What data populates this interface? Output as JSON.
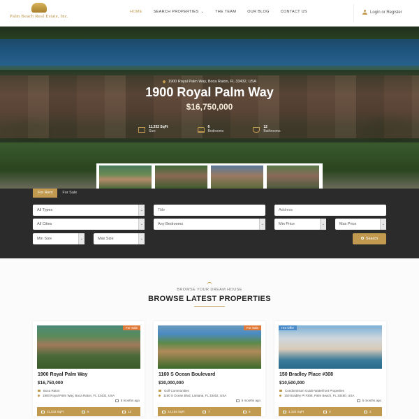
{
  "header": {
    "logo_text": "Palm Beach Real Estate, Inc.",
    "nav": [
      {
        "label": "HOME",
        "active": true
      },
      {
        "label": "SEARCH PROPERTIES",
        "active": false
      },
      {
        "label": "THE TEAM",
        "active": false
      },
      {
        "label": "OUR BLOG",
        "active": false
      },
      {
        "label": "CONTACT US",
        "active": false
      }
    ],
    "login_label": "Login or Register"
  },
  "hero": {
    "address": "1900 Royal Palm Way, Boca Raton, FL 33432, USA",
    "title": "1900 Royal Palm Way",
    "price": "$16,750,000",
    "stats": [
      {
        "value": "11,332 SqFt",
        "label": "Size"
      },
      {
        "value": "6",
        "label": "Bedrooms"
      },
      {
        "value": "12",
        "label": "Bathrooms"
      }
    ]
  },
  "search": {
    "tabs": [
      "For Rent",
      "For Sale"
    ],
    "types": "All Types",
    "title_placeholder": "Title",
    "address_placeholder": "Address",
    "cities": "All Cities",
    "bedrooms": "Any Bedrooms",
    "min_price": "Min Price",
    "max_price": "Max Price",
    "min_size": "Min Size",
    "max_size": "Max Size",
    "button": "Search"
  },
  "browse": {
    "subtitle": "BROWSE YOUR DREAM HOUSE",
    "title": "BROWSE LATEST PROPERTIES"
  },
  "cards": [
    {
      "badge": "For Sale",
      "title": "1900 Royal Palm Way",
      "price": "$16,750,000",
      "type": "Boca Raton",
      "address": "1900 Royal Palm Way, Boca Raton, FL 33432, USA",
      "time": "5 months ago",
      "size": "11,332 SqFt",
      "beds": "6",
      "baths": "12"
    },
    {
      "badge": "For Sale",
      "title": "1160 S Ocean Boulevard",
      "price": "$30,000,000",
      "type": "Golf Communities",
      "address": "1160 S Ocean Blvd, Lantana, FL 33462, USA",
      "time": "5 months ago",
      "size": "14,154 SqFt",
      "beds": "7",
      "baths": "9"
    },
    {
      "badge": "Hot Offer",
      "title": "150 Bradley Place #308",
      "price": "$10,500,000",
      "type": "Condominium Guide Waterfront Properties",
      "address": "150 Bradley Pl #308, Palm Beach, FL 33480, USA",
      "time": "5 months ago",
      "size": "2,330 SqFt",
      "beds": "3",
      "baths": "3"
    }
  ]
}
